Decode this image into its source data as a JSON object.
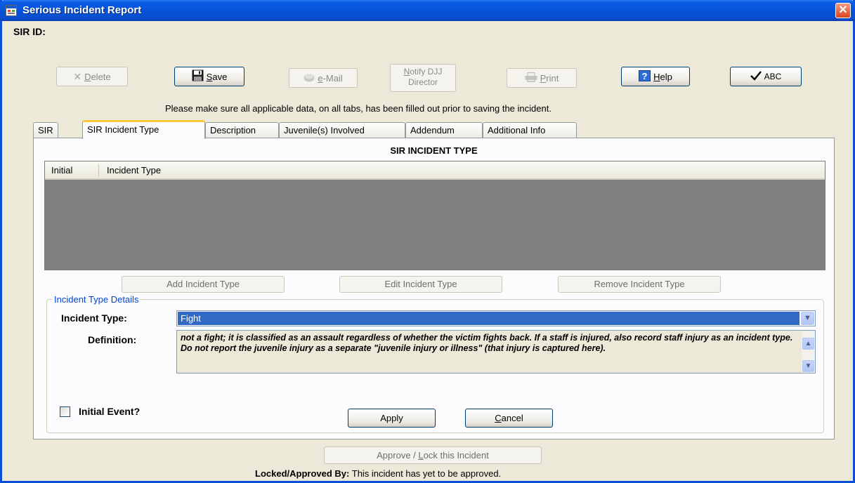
{
  "window": {
    "title": "Serious Incident Report",
    "close_glyph": "✕"
  },
  "sir_id_label": "SIR ID:",
  "toolbar": {
    "delete": {
      "mnemonic": "D",
      "rest": "elete",
      "icon": "close-icon"
    },
    "save": {
      "mnemonic": "S",
      "rest": "ave",
      "icon": "floppy-icon"
    },
    "email": {
      "mnemonic": "e",
      "rest": "-Mail",
      "icon": "mail-icon"
    },
    "notify": {
      "line1_mnemonic": "N",
      "line1_rest": "otify DJJ",
      "line2": "Director"
    },
    "print": {
      "mnemonic": "P",
      "rest": "rint",
      "icon": "printer-icon"
    },
    "help": {
      "mnemonic": "H",
      "rest": "elp",
      "icon": "help-icon"
    },
    "spell": {
      "label": "ABC",
      "icon": "checkmark-icon"
    }
  },
  "notice": "Please make sure all applicable data, on all tabs, has been filled out prior to saving the incident.",
  "tabs": [
    "SIR",
    "SIR Incident Type",
    "Description",
    "Juvenile(s) Involved",
    "Addendum",
    "Additional Info"
  ],
  "active_tab": "SIR Incident Type",
  "panel_title": "SIR INCIDENT TYPE",
  "grid": {
    "columns": [
      "Initial",
      "Incident Type"
    ],
    "rows": []
  },
  "grid_buttons": {
    "add": "Add Incident Type",
    "edit": "Edit Incident Type",
    "remove": "Remove Incident Type"
  },
  "details": {
    "legend": "Incident Type Details",
    "incident_type_label": "Incident Type:",
    "incident_type_value": "Fight",
    "definition_label": "Definition:",
    "definition_text": "not a fight; it is classified as an assault regardless of whether the victim fights back. If a staff is injured, also record staff injury as an incident type. Do not report the juvenile injury as a separate \"juvenile injury or illness\" (that injury is captured here).",
    "initial_event_label": "Initial Event?",
    "initial_event_checked": false,
    "apply": "Apply",
    "cancel_mnemonic": "C",
    "cancel_rest": "ancel"
  },
  "approve": {
    "before": "Approve / ",
    "mnemonic": "L",
    "after": "ock this Incident"
  },
  "locked": {
    "label": "Locked/Approved By:",
    "value": "This incident has yet to be approved."
  },
  "colors": {
    "title_bar": "#0653d8",
    "window_bg": "#ece9d8",
    "selection": "#316ac5",
    "legend_text": "#0046d5",
    "active_tab_highlight": "#ffc83c"
  }
}
